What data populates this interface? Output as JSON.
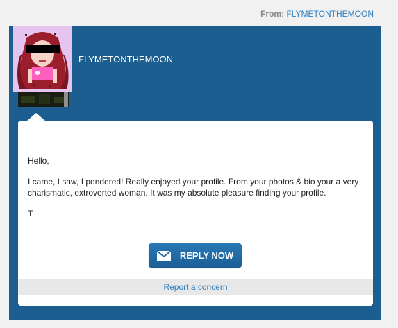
{
  "header": {
    "from_label": "From:",
    "from_name": "FLYMETONTHEMOON"
  },
  "profile": {
    "name": "FLYMETONTHEMOON"
  },
  "message": {
    "greeting": "Hello,",
    "body": "I came, I saw, I pondered! Really enjoyed your profile. From your photos & bio your a very charismatic, extroverted woman. It was my absolute pleasure finding your profile.",
    "signoff": "T"
  },
  "actions": {
    "reply_label": "REPLY NOW",
    "reply_icon": "envelope-icon",
    "report_label": "Report a concern"
  },
  "colors": {
    "panel": "#1b5e8f",
    "link": "#2f7fbf",
    "button": "#1f6aa5"
  }
}
